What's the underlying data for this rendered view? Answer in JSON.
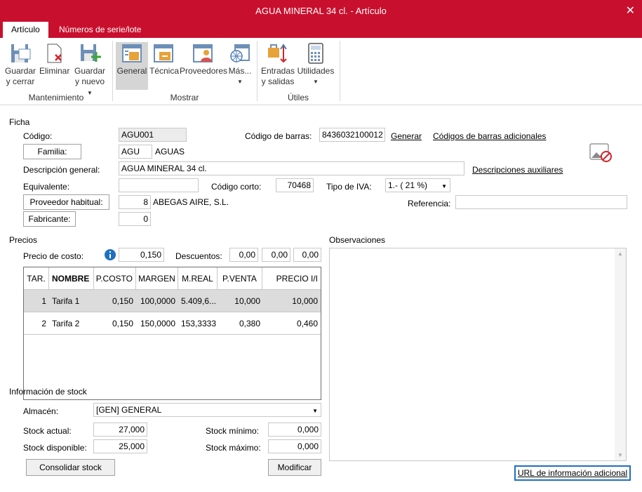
{
  "window": {
    "title": "AGUA MINERAL 34 cl. - Artículo",
    "close": "✕"
  },
  "tabs": [
    {
      "label": "Artículo"
    },
    {
      "label": "Números de serie/lote"
    }
  ],
  "ribbon": {
    "save_close": [
      "Guardar",
      "y cerrar"
    ],
    "delete": [
      "Eliminar"
    ],
    "save_new": [
      "Guardar",
      "y nuevo"
    ],
    "general": [
      "General"
    ],
    "tecnica": [
      "Técnica"
    ],
    "proveedores": [
      "Proveedores"
    ],
    "mas": [
      "Más..."
    ],
    "entradas": [
      "Entradas",
      "y salidas"
    ],
    "utilidades": [
      "Utilidades"
    ],
    "groups": {
      "mantenimiento": "Mantenimiento",
      "mostrar": "Mostrar",
      "utiles": "Útiles"
    }
  },
  "ficha": {
    "section": "Ficha",
    "codigo_label": "Código:",
    "codigo": "AGU001",
    "barras_label": "Código de barras:",
    "barras": "8436032100012",
    "generar": "Generar",
    "barras_adicionales": "Códigos de barras adicionales",
    "familia_button": "Familia:",
    "familia_code": "AGU",
    "familia_name": "AGUAS",
    "descripcion_label": "Descripción general:",
    "descripcion": "AGUA MINERAL 34 cl.",
    "descripciones_aux": "Descripciones auxiliares",
    "equivalente_label": "Equivalente:",
    "equivalente": "",
    "codigo_corto_label": "Código corto:",
    "codigo_corto": "70468",
    "iva_label": "Tipo de IVA:",
    "iva": "1.- ( 21 %)",
    "proveedor_button": "Proveedor habitual:",
    "proveedor_num": "8",
    "proveedor_name": "ABEGAS AIRE, S.L.",
    "referencia_label": "Referencia:",
    "referencia": "",
    "fabricante_button": "Fabricante:",
    "fabricante": "0"
  },
  "precios": {
    "section": "Precios",
    "coste_label": "Precio de costo:",
    "coste": "0,150",
    "descuentos_label": "Descuentos:",
    "descuentos": [
      "0,00",
      "0,00",
      "0,00"
    ],
    "columns": [
      "TAR.",
      "NOMBRE",
      "P.COSTO",
      "MARGEN",
      "M.REAL",
      "P.VENTA",
      "PRECIO I/I"
    ],
    "rows": [
      [
        "1",
        "Tarifa 1",
        "0,150",
        "100,0000",
        "5.409,6...",
        "10,000",
        "10,000"
      ],
      [
        "2",
        "Tarifa 2",
        "0,150",
        "150,0000",
        "153,3333",
        "0,380",
        "0,460"
      ]
    ]
  },
  "observaciones": {
    "section": "Observaciones",
    "text": ""
  },
  "stock": {
    "section": "Información de stock",
    "almacen_label": "Almacén:",
    "almacen": "[GEN] GENERAL",
    "actual_label": "Stock actual:",
    "actual": "27,000",
    "minimo_label": "Stock mínimo:",
    "minimo": "0,000",
    "disponible_label": "Stock disponible:",
    "disponible": "25,000",
    "maximo_label": "Stock máximo:",
    "maximo": "0,000",
    "consolidar": "Consolidar stock",
    "modificar": "Modificar"
  },
  "url_button": "URL de información adicional",
  "colors": {
    "accent": "#c8102e",
    "selected_row": "#dcdcdc",
    "info_icon": "#1f6fbf"
  }
}
